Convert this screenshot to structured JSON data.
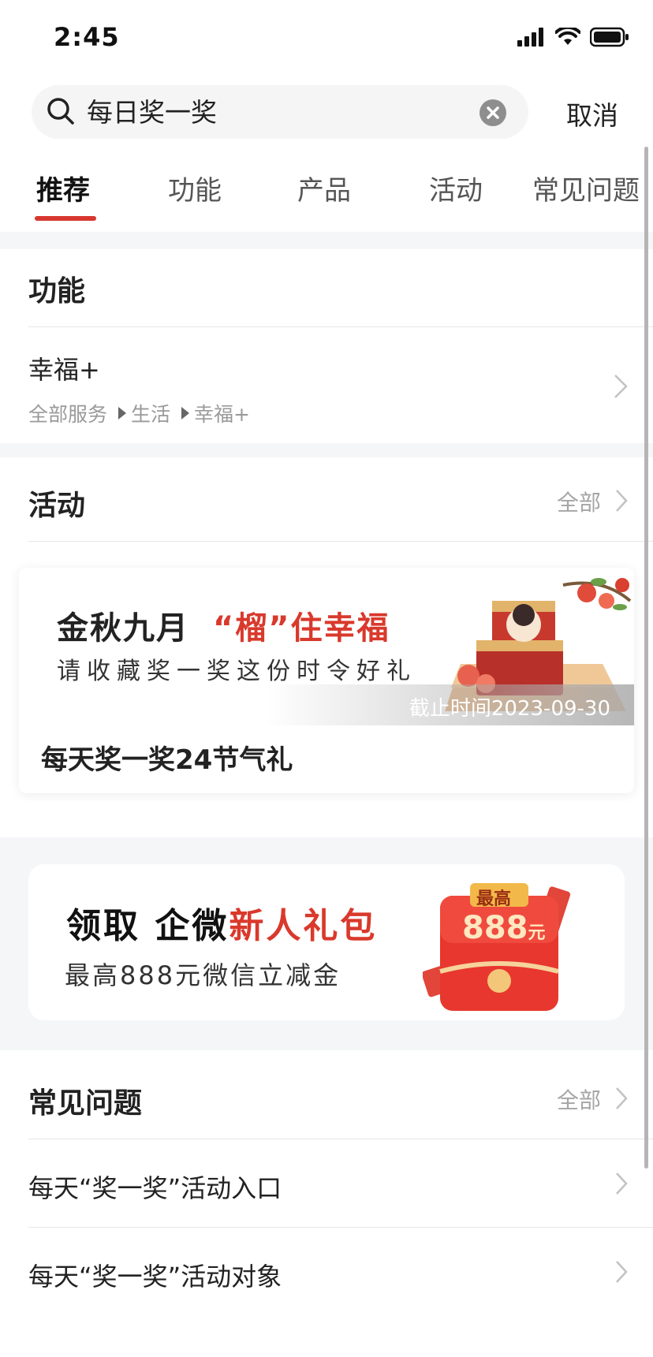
{
  "status_bar": {
    "time": "2:45"
  },
  "search": {
    "query": "每日奖一奖",
    "cancel_label": "取消"
  },
  "tabs": [
    {
      "label": "推荐",
      "active": true
    },
    {
      "label": "功能",
      "active": false
    },
    {
      "label": "产品",
      "active": false
    },
    {
      "label": "活动",
      "active": false
    },
    {
      "label": "常见问题",
      "active": false
    }
  ],
  "features": {
    "title": "功能",
    "items": [
      {
        "title": "幸福+",
        "breadcrumb": [
          "全部服务",
          "生活",
          "幸福+"
        ]
      }
    ]
  },
  "activities": {
    "title": "活动",
    "all_label": "全部",
    "card": {
      "banner_heading_part1": "金秋九月",
      "banner_heading_part2": "“榴”住幸福",
      "banner_subtitle": "请收藏奖一奖这份时令好礼",
      "deadline": "截止时间2023-09-30",
      "name": "每天奖一奖24节气礼"
    }
  },
  "promo": {
    "heading_part1": "领取 企微",
    "heading_part2": "新人礼包",
    "subtitle": "最高888元微信立减金",
    "packet_top": "最高",
    "packet_amount": "888",
    "packet_unit": "元"
  },
  "faq": {
    "title": "常见问题",
    "all_label": "全部",
    "items": [
      {
        "title": "每天“奖一奖”活动入口"
      },
      {
        "title": "每天“奖一奖”活动对象"
      }
    ]
  },
  "colors": {
    "accent_red": "#d8382f",
    "page_gray": "#f5f6f8"
  }
}
